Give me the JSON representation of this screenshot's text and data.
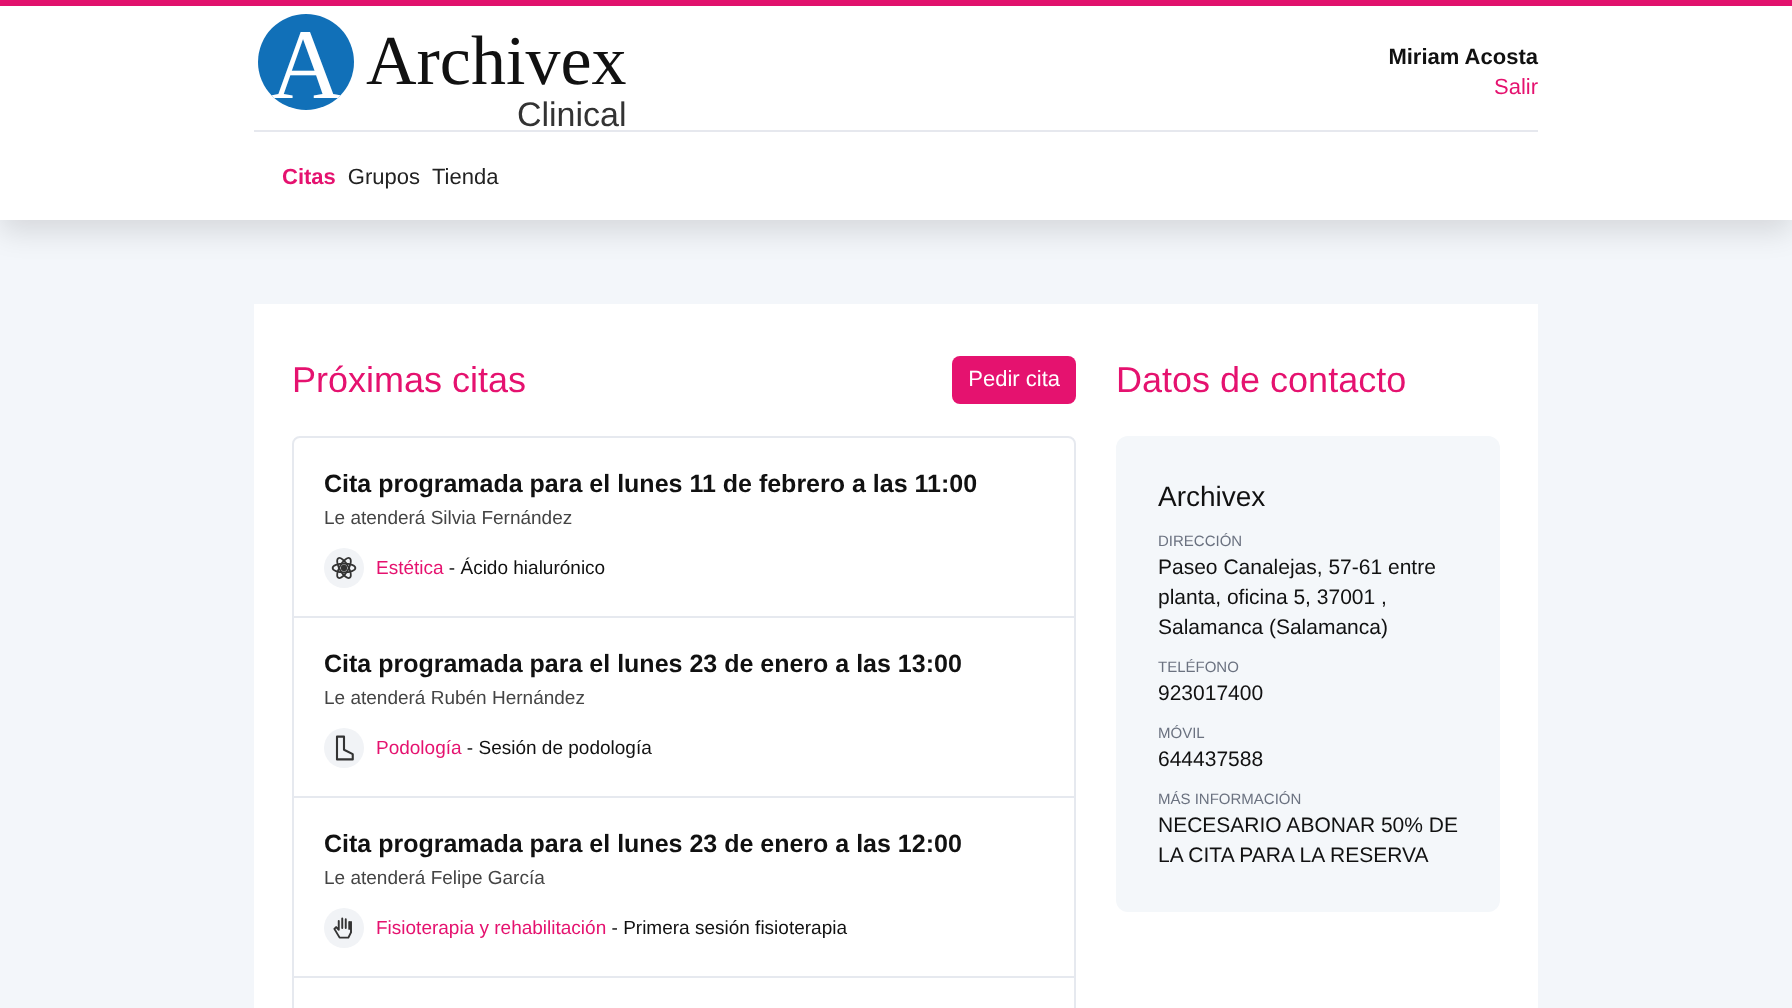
{
  "header": {
    "logo": {
      "letter": "A",
      "name": "Archivex",
      "subtitle": "Clinical"
    },
    "user": {
      "name": "Miriam Acosta",
      "logout": "Salir"
    },
    "nav": [
      {
        "label": "Citas",
        "selected": true
      },
      {
        "label": "Grupos",
        "selected": false
      },
      {
        "label": "Tienda",
        "selected": false
      }
    ]
  },
  "appointments": {
    "title": "Próximas citas",
    "button": "Pedir cita",
    "items": [
      {
        "title": "Cita programada para el lunes 11  de febrero  a las 11:00",
        "staff": "Le atenderá Silvia Fernández",
        "kind": "aesthetic",
        "service": "Estética",
        "detail": " - Ácido hialurónico"
      },
      {
        "title": "Cita programada para el lunes 23 de enero a las 13:00",
        "staff": "Le atenderá Rubén Hernández",
        "kind": "podiatry",
        "service": "Podología",
        "detail": " - Sesión de podología"
      },
      {
        "title": "Cita programada para el lunes 23 de enero a las 12:00",
        "staff": "Le atenderá Felipe García",
        "kind": "physio",
        "service": "Fisioterapia y rehabilitación",
        "detail": " - Primera sesión fisioterapia"
      }
    ]
  },
  "contact": {
    "title": "Datos de contacto",
    "name": "Archivex",
    "fields": [
      {
        "label": "DIRECCIÓN",
        "value": "Paseo Canalejas, 57-61 entre planta, oficina 5, 37001 , Salamanca (Salamanca)"
      },
      {
        "label": "TELÉFONO",
        "value": "923017400"
      },
      {
        "label": "MÓVIL",
        "value": "644437588"
      },
      {
        "label": "MÁS INFORMACIÓN",
        "value": "NECESARIO ABONAR 50% DE LA CITA PARA LA RESERVA"
      }
    ]
  }
}
